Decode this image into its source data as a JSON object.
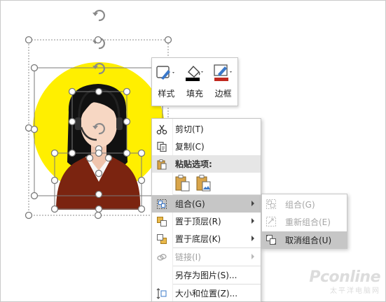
{
  "mini_toolbar": {
    "style_label": "样式",
    "fill_label": "填充",
    "border_label": "边框",
    "colors": {
      "fill": "#000000",
      "border": "#c0281e"
    }
  },
  "context_menu": {
    "cut": "剪切(T)",
    "copy": "复制(C)",
    "paste_options": "粘贴选项:",
    "group": "组合(G)",
    "bring_to_front": "置于顶层(R)",
    "send_to_back": "置于底层(K)",
    "link": "链接(I)",
    "save_as_picture": "另存为图片(S)...",
    "size_position": "大小和位置(Z)..."
  },
  "submenu": {
    "group": "组合(G)",
    "regroup": "重新组合(E)",
    "ungroup": "取消组合(U)"
  },
  "watermark": {
    "brand": "Pconline",
    "sub": "太平洋电脑网"
  },
  "colors": {
    "circle": "#ffef00",
    "hair": "#111111",
    "skin": "#f7d7c3",
    "shirt": "#7b2410",
    "highlight": "#c6c6c6"
  }
}
